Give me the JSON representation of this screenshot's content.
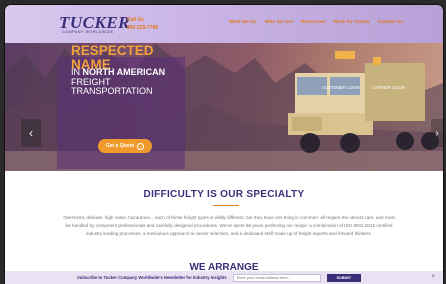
{
  "header": {
    "logo_text": "TUCKER",
    "logo_sub": "COMPANY WORLDWIDE",
    "call_label": "Call Us",
    "call_number": "800-229-7780",
    "nav": [
      "What We Do",
      "Who We Are",
      "Resources",
      "Work for Tucker",
      "Contact Us"
    ]
  },
  "hero": {
    "login_links": [
      "CUSTOMER LOGIN",
      "CARRIER LOGIN"
    ],
    "title": "THE MOST RESPECTED NAME",
    "sub_prefix": "IN ",
    "sub_bold": "NORTH AMERICAN",
    "sub_rest": " FREIGHT TRANSPORTATION",
    "quote_button": "Get a Quote",
    "quote_icon": "›",
    "arrow_left": "‹",
    "arrow_right": "›"
  },
  "section": {
    "title": "DIFFICULTY IS OUR SPECIALTY",
    "body": "Oversized, delicate, high value, hazardous... each of these freight types is wildly different, but they have one thing in common: all require the utmost care, and must be handled by competent professionals and carefully designed procedures. We've spent 66 years perfecting our recipe: a combination of ISO 9001:2015 certified industry leading processes, a meticulous approach to carrier selection, and a dedicated staff made up of freight experts and forward thinkers."
  },
  "section2": {
    "title": "WE ARRANGE"
  },
  "newsletter": {
    "text": "Subscribe to Tucker Company Worldwide's Newsletter for Industry Insights",
    "placeholder": "Enter your email address here...",
    "submit": "SUBMIT",
    "close": "×"
  },
  "colors": {
    "brand": "#3a2f7a",
    "accent": "#e07a1e",
    "button": "#f09a2e"
  }
}
